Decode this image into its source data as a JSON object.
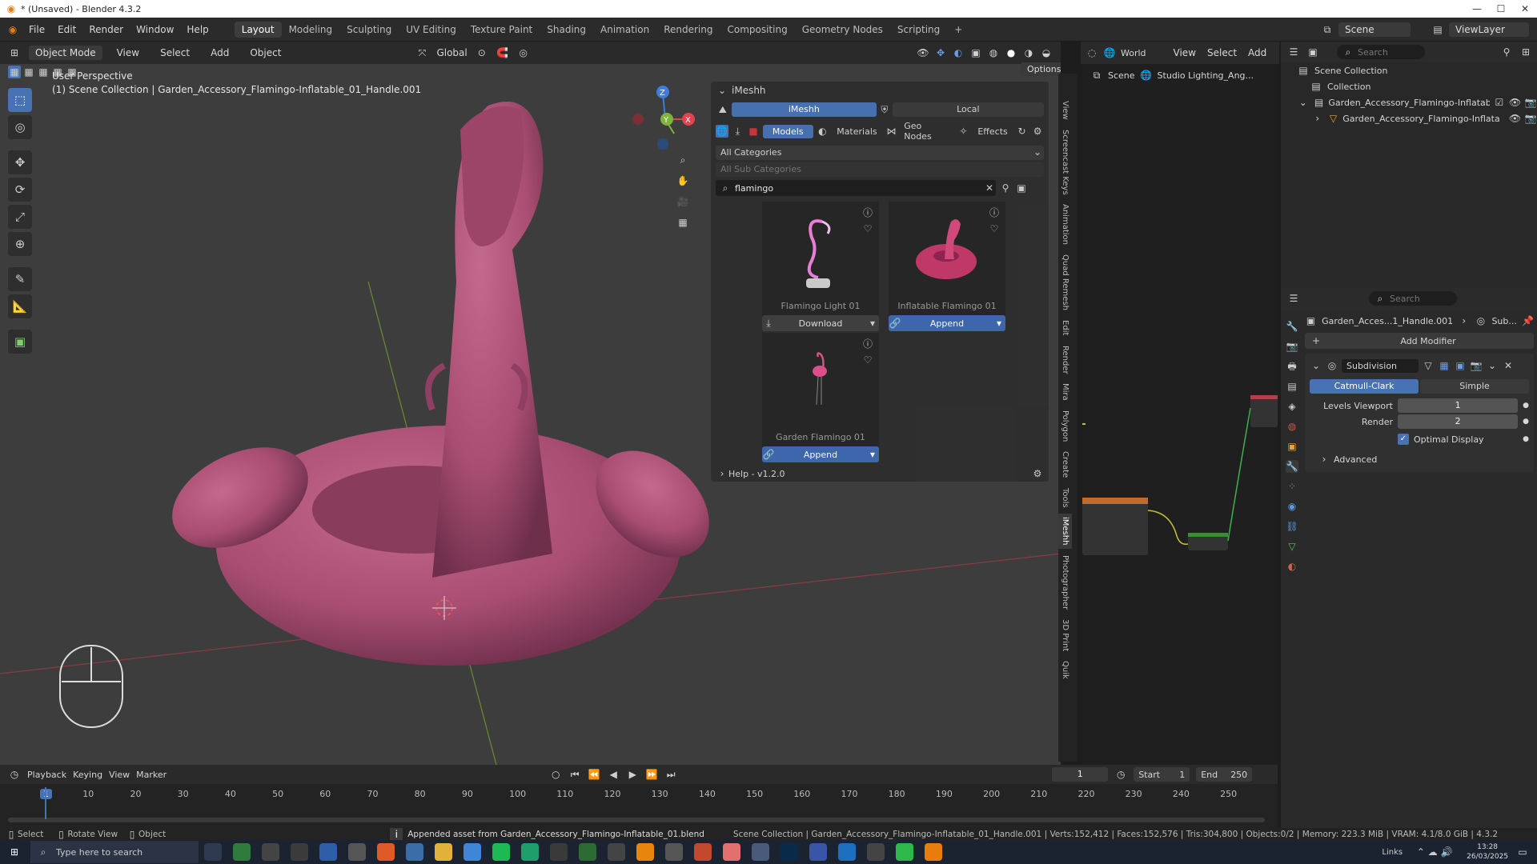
{
  "window": {
    "title": "* (Unsaved) - Blender 4.3.2"
  },
  "menus": [
    "File",
    "Edit",
    "Render",
    "Window",
    "Help"
  ],
  "workspaces": [
    "Layout",
    "Modeling",
    "Sculpting",
    "UV Editing",
    "Texture Paint",
    "Shading",
    "Animation",
    "Rendering",
    "Compositing",
    "Geometry Nodes",
    "Scripting"
  ],
  "active_workspace": "Layout",
  "scene": {
    "name": "Scene",
    "view_layer": "ViewLayer"
  },
  "viewport": {
    "mode": "Object Mode",
    "menus": [
      "View",
      "Select",
      "Add",
      "Object"
    ],
    "orientation": "Global",
    "options_label": "Options",
    "perspective": "User Perspective",
    "collection_line": "(1) Scene Collection | Garden_Accessory_Flamingo-Inflatable_01_Handle.001",
    "gizmo": {
      "x": "X",
      "y": "Y",
      "z": "Z"
    }
  },
  "imeshh": {
    "panel_title": "iMeshh",
    "tabs": {
      "primary": "iMeshh",
      "secondary": "Local"
    },
    "subtabs": [
      "Models",
      "Materials",
      "Geo Nodes",
      "Effects"
    ],
    "category": "All Categories",
    "subcategory": "All Sub Categories",
    "search_value": "flamingo",
    "items": [
      {
        "name": "Flamingo Light 01",
        "action": "Download"
      },
      {
        "name": "Inflatable Flamingo 01",
        "action": "Append"
      },
      {
        "name": "Garden Flamingo 01",
        "action": "Append"
      }
    ],
    "help": "Help - v1.2.0"
  },
  "side_tabs": [
    "View",
    "Screencast Keys",
    "Animation",
    "Quad Remesh",
    "Edit",
    "Render",
    "Mira",
    "Polygon",
    "Create",
    "Tools",
    "iMeshh",
    "Photographer",
    "3D Print",
    "Quik"
  ],
  "node_editor": {
    "world": "World",
    "menus": [
      "View",
      "Select",
      "Add"
    ],
    "breadcrumb": [
      "Scene",
      "Studio Lighting_Ang..."
    ]
  },
  "outliner": {
    "search_placeholder": "Search",
    "items": [
      "Scene Collection",
      "Collection",
      "Garden_Accessory_Flamingo-Inflatable_",
      "Garden_Accessory_Flamingo-Inflata"
    ]
  },
  "properties": {
    "search_placeholder": "Search",
    "object_name": "Garden_Acces...1_Handle.001",
    "breadcrumb_tail": "Sub...",
    "add_modifier": "Add Modifier",
    "modifier": {
      "name": "Subdivision",
      "types": [
        "Catmull-Clark",
        "Simple"
      ],
      "levels_viewport_label": "Levels Viewport",
      "levels_viewport": "1",
      "render_label": "Render",
      "render": "2",
      "optimal_display": "Optimal Display",
      "advanced": "Advanced"
    }
  },
  "timeline": {
    "menus": [
      "Playback",
      "Keying",
      "View",
      "Marker"
    ],
    "current_frame": "1",
    "start_label": "Start",
    "start": "1",
    "end_label": "End",
    "end": "250",
    "ticks": [
      "1",
      "10",
      "20",
      "30",
      "40",
      "50",
      "60",
      "70",
      "80",
      "90",
      "100",
      "110",
      "120",
      "130",
      "140",
      "150",
      "160",
      "170",
      "180",
      "190",
      "200",
      "210",
      "220",
      "230",
      "240",
      "250"
    ]
  },
  "statusbar": {
    "select": "Select",
    "rotate": "Rotate View",
    "object": "Object",
    "message": "Appended asset from Garden_Accessory_Flamingo-Inflatable_01.blend",
    "stats": "Scene Collection | Garden_Accessory_Flamingo-Inflatable_01_Handle.001 | Verts:152,412 | Faces:152,576 | Tris:304,800 | Objects:0/2 | Memory: 223.3 MiB | VRAM: 4.1/8.0 GiB | 4.3.2"
  },
  "taskbar": {
    "search_placeholder": "Type here to search",
    "time": "13:28",
    "date": "26/03/2025",
    "links": "Links"
  },
  "colors": {
    "flamingo": "#a94e72",
    "accent": "#4772b3",
    "append": "#3d68b1"
  }
}
